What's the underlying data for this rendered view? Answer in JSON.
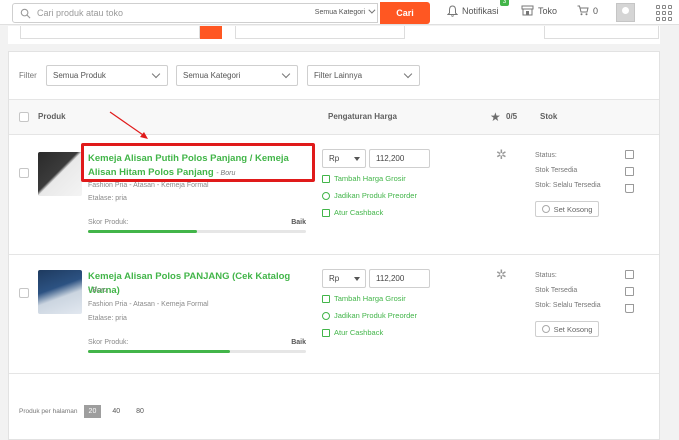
{
  "header": {
    "search_placeholder": "Cari produk atau toko",
    "category_select": "Semua Kategori",
    "search_button": "Cari",
    "notif_label": "Notifikasi",
    "notif_count": "3",
    "shop_label": "Toko",
    "cart_count": "0"
  },
  "filters": {
    "label": "Filter",
    "product_select": "Semua Produk",
    "category_select": "Semua Kategori",
    "other_select": "Filter Lainnya"
  },
  "table": {
    "col_product": "Produk",
    "col_price": "Pengaturan Harga",
    "col_rating": "0/5",
    "col_stock": "Stok"
  },
  "products": [
    {
      "name": "Kemeja Alisan Putih Polos Panjang / Kemeja Alisan Hitam Polos Panjang",
      "brand": "- Boru",
      "category": "Fashion Pria - Atasan - Kemeja Formal",
      "etalase": "Etalase: pria",
      "score_label": "Skor Produk:",
      "score_value": "Baik",
      "score_fraction": 0.5,
      "currency": "Rp",
      "price": "112,200",
      "action_grosir": "Tambah Harga Grosir",
      "action_preorder": "Jadikan Produk Preorder",
      "action_cashback": "Atur Cashback",
      "status_label": "Status:",
      "status_value": "Stok Tersedia",
      "stock_value": "Stok:  Selalu Tersedia",
      "set_empty": "Set Kosong"
    },
    {
      "name": "Kemeja Alisan Polos PANJANG (Cek Katalog Warna)",
      "brand": "- Boru",
      "category": "Fashion Pria - Atasan - Kemeja Formal",
      "etalase": "Etalase: pria",
      "score_label": "Skor Produk:",
      "score_value": "Baik",
      "score_fraction": 0.65,
      "currency": "Rp",
      "price": "112,200",
      "action_grosir": "Tambah Harga Grosir",
      "action_preorder": "Jadikan Produk Preorder",
      "action_cashback": "Atur Cashback",
      "status_label": "Status:",
      "status_value": "Stok Tersedia",
      "stock_value": "Stok:  Selalu Tersedia",
      "set_empty": "Set Kosong"
    }
  ],
  "pagination": {
    "label": "Produk per halaman",
    "options": [
      "20",
      "40",
      "80"
    ],
    "active": "20"
  },
  "colors": {
    "accent_orange": "#ff5722",
    "brand_green": "#42b549",
    "highlight_red": "#e01a1a"
  }
}
